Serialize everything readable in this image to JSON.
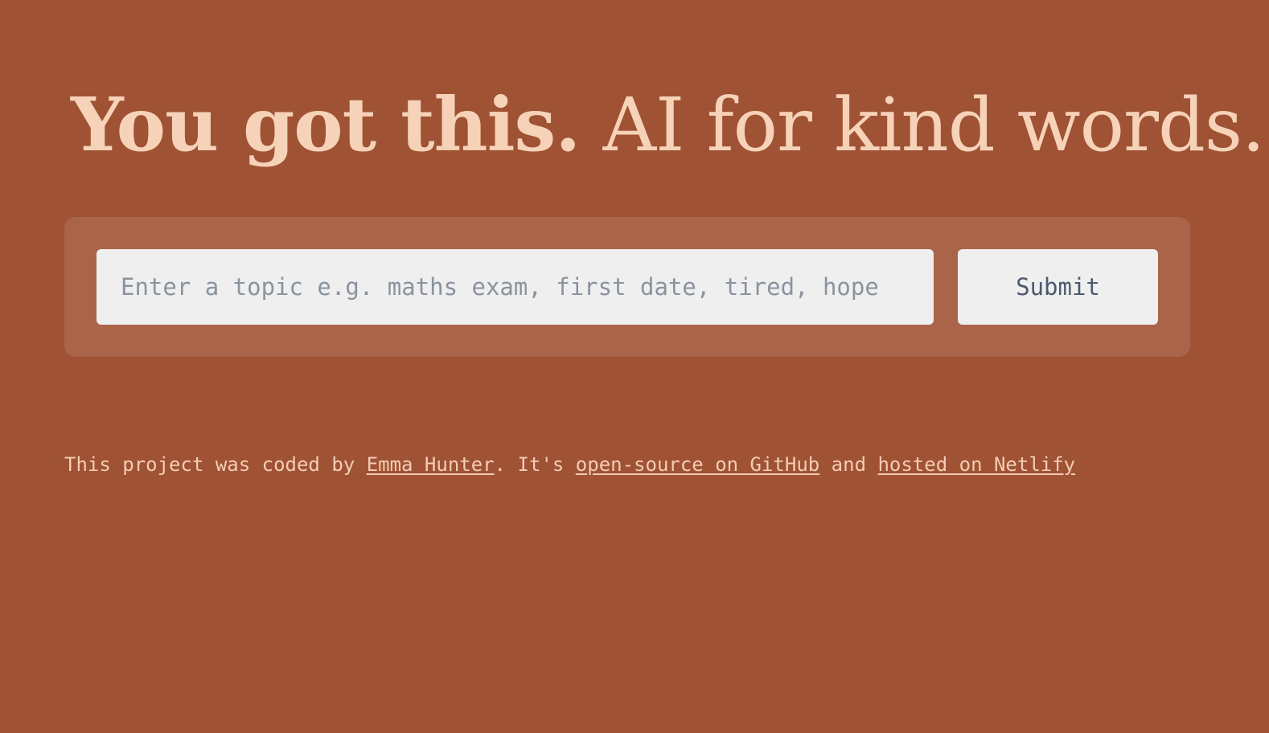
{
  "hero": {
    "headline_strong": "You got this.",
    "headline_rest": " AI for kind words."
  },
  "form": {
    "topic_placeholder": "Enter a topic e.g. maths exam, first date, tired, hope",
    "topic_value": "",
    "submit_label": "Submit"
  },
  "footer": {
    "text_before_author": "This project was coded by ",
    "author_link": "Emma Hunter",
    "text_before_repo": ". It's ",
    "repo_link": "open-source on GitHub",
    "text_before_host": " and ",
    "host_link": "hosted on Netlify"
  },
  "colors": {
    "background": "#A05235",
    "panel": "#AA644A",
    "headline": "#F6D3B8",
    "control_background": "#EFEFF0",
    "footer_text": "#F3CDB3"
  }
}
